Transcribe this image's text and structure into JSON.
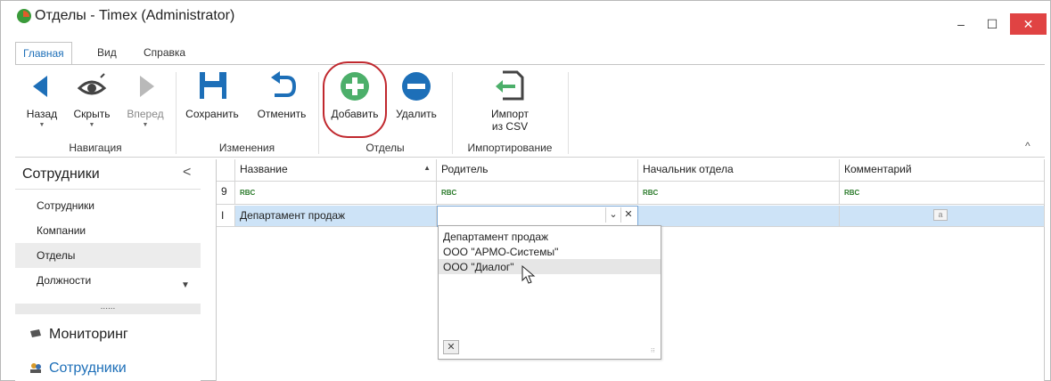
{
  "window": {
    "title": "Отделы - Timex (Administrator)",
    "controls": {
      "minimize": "–",
      "maximize": "☐",
      "close": "✕"
    },
    "accent": "#1d6fb8",
    "close_color": "#e04343"
  },
  "ribbon": {
    "tabs": [
      {
        "label": "Главная",
        "active": true
      },
      {
        "label": "Вид",
        "active": false
      },
      {
        "label": "Справка",
        "active": false
      }
    ],
    "groups": {
      "navigation": {
        "label": "Навигация",
        "back": "Назад",
        "hide": "Скрыть",
        "forward": "Вперед"
      },
      "changes": {
        "label": "Изменения",
        "save": "Сохранить",
        "cancel": "Отменить"
      },
      "departments": {
        "label": "Отделы",
        "add": "Добавить",
        "delete": "Удалить"
      },
      "import": {
        "label": "Импортирование",
        "import_line1": "Импорт",
        "import_line2": "из CSV"
      }
    },
    "collapse_glyph": "^"
  },
  "nav": {
    "header": "Сотрудники",
    "collapse_glyph": "<",
    "items": [
      {
        "label": "Сотрудники",
        "selected": false
      },
      {
        "label": "Компании",
        "selected": false
      },
      {
        "label": "Отделы",
        "selected": true
      },
      {
        "label": "Должности",
        "selected": false
      }
    ],
    "grip": "......",
    "sections": [
      {
        "label": "Мониторинг",
        "icon": "monitor-icon",
        "active": false
      },
      {
        "label": "Сотрудники",
        "icon": "people-icon",
        "active": true
      }
    ]
  },
  "grid": {
    "columns": [
      "Название",
      "Родитель",
      "Начальник отдела",
      "Комментарий"
    ],
    "sorted_column": "Название",
    "sort_direction": "ascending",
    "filter_icon": "RBC",
    "rows": [
      {
        "name": "Департамент продаж",
        "parent": "",
        "head": "",
        "comment": ""
      }
    ],
    "editing_row_indicator": "I",
    "filter_row_indicator": "9"
  },
  "dropdown": {
    "options": [
      "Департамент продаж",
      "ООО \"АРМО-Системы\"",
      "ООО \"Диалог\""
    ],
    "hovered_index": 2,
    "clear_glyph": "✕"
  }
}
